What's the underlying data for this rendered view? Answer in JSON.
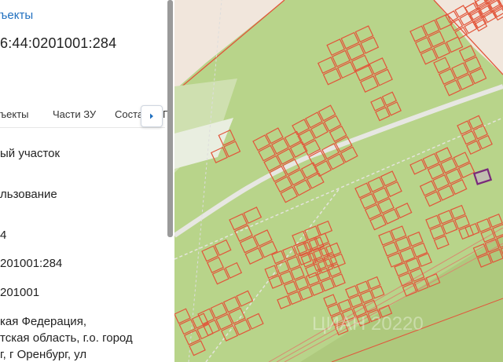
{
  "panel": {
    "objects_link": "ъекты",
    "cadastral_number": "6:44:0201001:284",
    "tabs": [
      "ъекты",
      "Части ЗУ",
      "Соста",
      "Г"
    ],
    "rows": [
      "ый участок",
      "льзование",
      "4",
      "201001:284",
      "201001",
      "кая Федерация,",
      "тская область, г.о. город",
      "г, г Оренбург, ул"
    ]
  },
  "icons": {
    "tab_next": "chevron-right-icon"
  },
  "colors": {
    "link": "#1f6fbf",
    "map_background": "#b7d38a",
    "parcel_border": "#e2553a",
    "selected_parcel": "#7a2a7a",
    "road": "#e7e7e2"
  },
  "map": {
    "watermark": "ЦИАН 20220"
  }
}
